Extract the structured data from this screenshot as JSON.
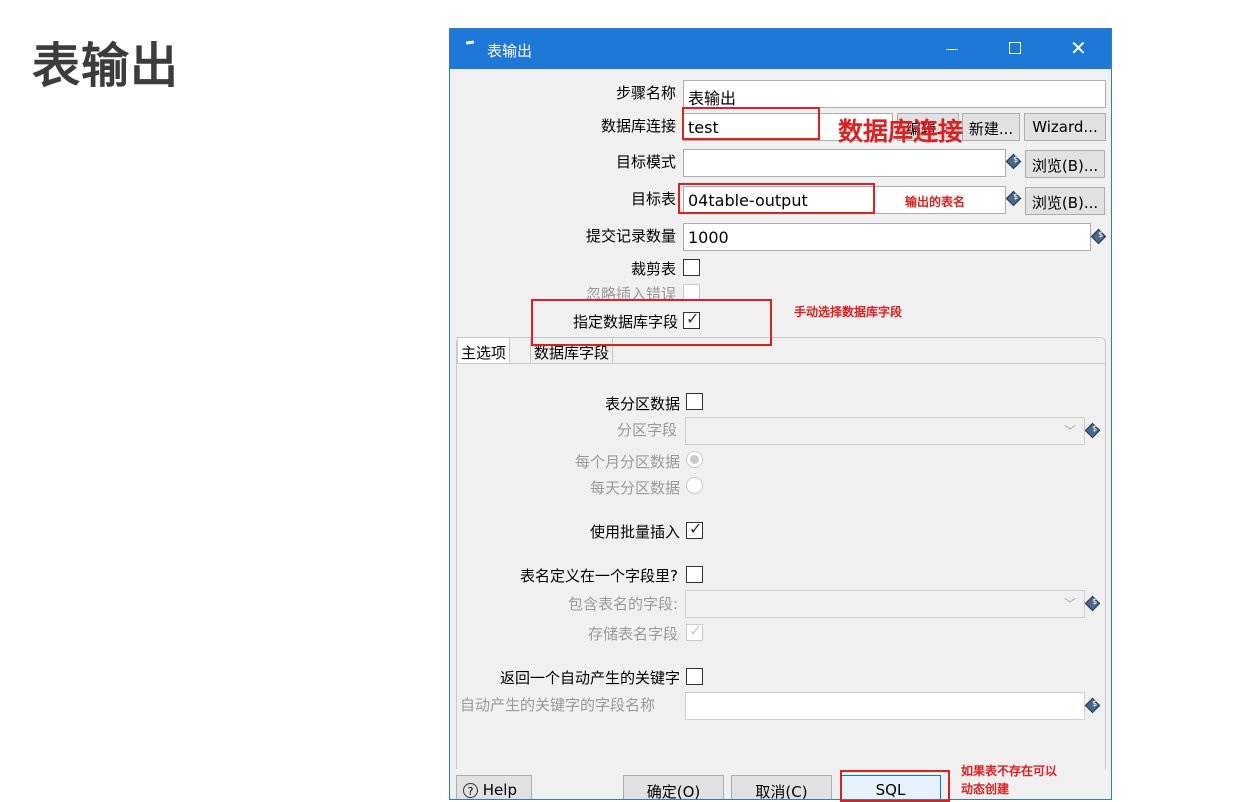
{
  "slide": {
    "title": "表输出"
  },
  "window": {
    "title": "表输出",
    "min_glyph": "—",
    "max_glyph": "☐",
    "close_glyph": "✕"
  },
  "form": {
    "step_name": {
      "label": "步骤名称",
      "value": "表输出"
    },
    "db_connection": {
      "label": "数据库连接",
      "value": "test",
      "edit_label": "编辑...",
      "new_label": "新建...",
      "wizard_label": "Wizard..."
    },
    "target_schema": {
      "label": "目标模式",
      "value": "",
      "browse_label": "浏览(B)..."
    },
    "target_table": {
      "label": "目标表",
      "value": "04table-output",
      "browse_label": "浏览(B)..."
    },
    "commit_size": {
      "label": "提交记录数量",
      "value": "1000"
    },
    "truncate": {
      "label": "裁剪表",
      "checked": false
    },
    "ignore_errors": {
      "label": "忽略插入错误",
      "checked": false
    },
    "specify_fields": {
      "label": "指定数据库字段",
      "checked": true
    }
  },
  "tabs": [
    {
      "label": "主选项"
    },
    {
      "label": "数据库字段"
    }
  ],
  "main_tab": {
    "partition_data": {
      "label": "表分区数据"
    },
    "partition_field": {
      "label": "分区字段"
    },
    "monthly": {
      "label": "每个月分区数据"
    },
    "daily": {
      "label": "每天分区数据"
    },
    "batch_insert": {
      "label": "使用批量插入"
    },
    "table_in_field": {
      "label": "表名定义在一个字段里?"
    },
    "table_name_field": {
      "label": "包含表名的字段:"
    },
    "store_table_name": {
      "label": "存储表名字段"
    },
    "return_key": {
      "label": "返回一个自动产生的关键字"
    },
    "key_field_name": {
      "label": "自动产生的关键字的字段名称"
    }
  },
  "footer": {
    "help_label": "Help",
    "ok_label": "确定(O)",
    "cancel_label": "取消(C)",
    "sql_label": "SQL"
  },
  "annotations": {
    "db_connection": "数据库连接",
    "output_table": "输出的表名",
    "manual_fields": "手动选择数据库字段",
    "sql_note_line1": "如果表不存在可以",
    "sql_note_line2": "动态创建"
  },
  "colors": {
    "titlebar": "#1e78d7",
    "annotation": "#e02020",
    "window_bg": "#f0f0f0"
  }
}
